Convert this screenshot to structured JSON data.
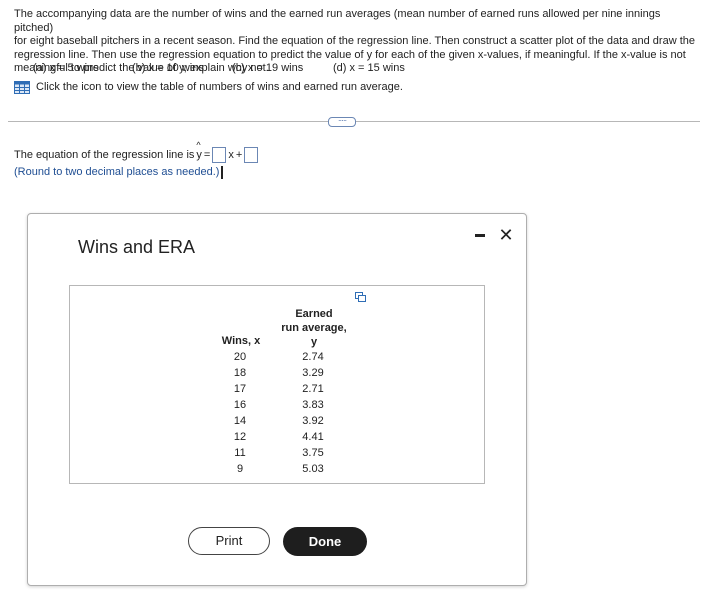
{
  "problem": {
    "prompt_line1": "The accompanying data are the number of wins and the earned run averages (mean number of earned runs allowed per nine innings pitched)",
    "prompt_line2": "for eight baseball pitchers in a recent season. Find the equation of the regression line. Then construct a scatter plot of the data and draw the",
    "prompt_line3": "regression line. Then use the regression equation to predict the value of y for each of the given x-values, if meaningful. If the x-value is not",
    "prompt_line4": "meaningful to predict the value of y, explain why not.",
    "parts": [
      "(a) x = 5 wins",
      "(b) x = 10 wins",
      "(c) x = 19 wins",
      "(d) x = 15 wins"
    ],
    "table_link_text": "Click the icon to view the table of numbers of wins and earned run average."
  },
  "expand_button_label": "·····",
  "equation": {
    "prefix": "The equation of the regression line is",
    "y_symbol": "y",
    "equals": "=",
    "x_symbol": "x",
    "plus": "+",
    "slope_value": "",
    "intercept_value": "",
    "round_note": "(Round to two decimal places as needed.)"
  },
  "dialog": {
    "title": "Wins and ERA",
    "minimize_icon": "minimize-icon",
    "close_label": "✕",
    "table": {
      "col1_header": "Wins, x",
      "col2_header_line1": "Earned",
      "col2_header_line2": "run average,",
      "col2_header_line3": "y",
      "rows": [
        {
          "wins": "20",
          "era": "2.74"
        },
        {
          "wins": "18",
          "era": "3.29"
        },
        {
          "wins": "17",
          "era": "2.71"
        },
        {
          "wins": "16",
          "era": "3.83"
        },
        {
          "wins": "14",
          "era": "3.92"
        },
        {
          "wins": "12",
          "era": "4.41"
        },
        {
          "wins": "11",
          "era": "3.75"
        },
        {
          "wins": "9",
          "era": "5.03"
        }
      ]
    },
    "print_label": "Print",
    "done_label": "Done"
  },
  "colors": {
    "accent_blue": "#1f4e93",
    "done_button_bg": "#1e1e1e",
    "answer_box_border": "#6b87b4"
  }
}
